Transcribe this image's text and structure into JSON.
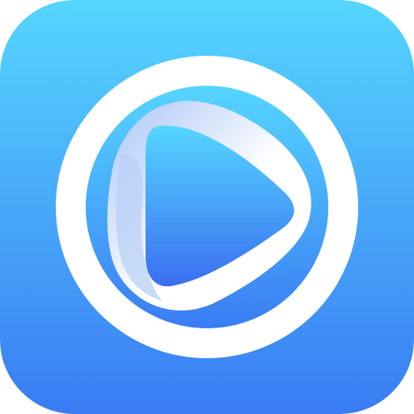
{
  "icon": {
    "name": "video-player-app-icon",
    "depicts": "play-icon",
    "colors": {
      "background_top": "#55D6FF",
      "background_bottom": "#3A7CF3",
      "ring": "#FFFFFF",
      "ribbon_light": "#FFFFFF",
      "ribbon_shade": "#A9C4F6",
      "play_top": "#55D6FF",
      "play_bottom": "#3A6EF0"
    }
  }
}
